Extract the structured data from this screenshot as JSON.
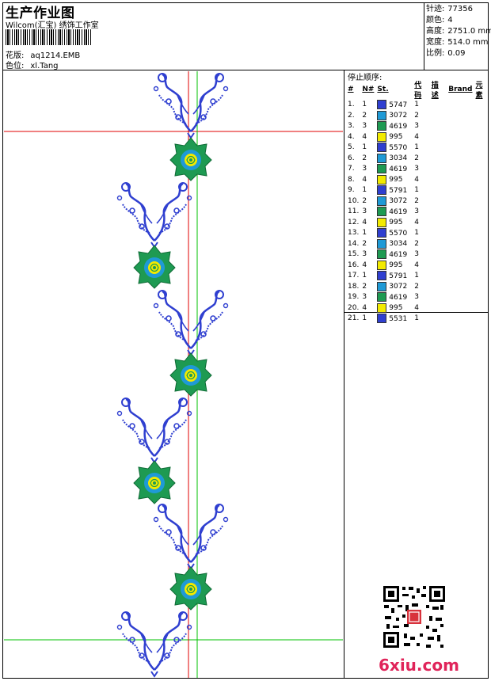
{
  "header": {
    "title": "生产作业图",
    "company": "Wilcom(汇宝) 绣饰工作室",
    "pattern_label": "花版:",
    "pattern_value": "aq1214.EMB",
    "color_label": "色位:",
    "color_value": "xl.Tang"
  },
  "stats": [
    {
      "label": "针迹:",
      "value": "77356"
    },
    {
      "label": "颜色:",
      "value": "4"
    },
    {
      "label": "高度:",
      "value": "2751.0 mm"
    },
    {
      "label": "宽度:",
      "value": "514.0 mm"
    },
    {
      "label": "比例:",
      "value": "0.09"
    }
  ],
  "stop_sequence": {
    "title": "停止顺序:",
    "columns": [
      "#",
      "N#",
      "St.",
      "代码",
      "描述",
      "Brand",
      "元素"
    ],
    "rows": [
      {
        "idx": "1.",
        "n": "1",
        "color": "#2f3fd0",
        "code": "5747",
        "desc": "1"
      },
      {
        "idx": "2.",
        "n": "2",
        "color": "#1f9ad6",
        "code": "3072",
        "desc": "2"
      },
      {
        "idx": "3.",
        "n": "3",
        "color": "#1e9a52",
        "code": "4619",
        "desc": "3"
      },
      {
        "idx": "4.",
        "n": "4",
        "color": "#f2ea00",
        "code": "995",
        "desc": "4"
      },
      {
        "idx": "5.",
        "n": "1",
        "color": "#2f3fd0",
        "code": "5570",
        "desc": "1"
      },
      {
        "idx": "6.",
        "n": "2",
        "color": "#1f9ad6",
        "code": "3034",
        "desc": "2"
      },
      {
        "idx": "7.",
        "n": "3",
        "color": "#1e9a52",
        "code": "4619",
        "desc": "3"
      },
      {
        "idx": "8.",
        "n": "4",
        "color": "#f2ea00",
        "code": "995",
        "desc": "4"
      },
      {
        "idx": "9.",
        "n": "1",
        "color": "#2f3fd0",
        "code": "5791",
        "desc": "1"
      },
      {
        "idx": "10.",
        "n": "2",
        "color": "#1f9ad6",
        "code": "3072",
        "desc": "2"
      },
      {
        "idx": "11.",
        "n": "3",
        "color": "#1e9a52",
        "code": "4619",
        "desc": "3"
      },
      {
        "idx": "12.",
        "n": "4",
        "color": "#f2ea00",
        "code": "995",
        "desc": "4"
      },
      {
        "idx": "13.",
        "n": "1",
        "color": "#2f3fd0",
        "code": "5570",
        "desc": "1"
      },
      {
        "idx": "14.",
        "n": "2",
        "color": "#1f9ad6",
        "code": "3034",
        "desc": "2"
      },
      {
        "idx": "15.",
        "n": "3",
        "color": "#1e9a52",
        "code": "4619",
        "desc": "3"
      },
      {
        "idx": "16.",
        "n": "4",
        "color": "#f2ea00",
        "code": "995",
        "desc": "4"
      },
      {
        "idx": "17.",
        "n": "1",
        "color": "#2f3fd0",
        "code": "5791",
        "desc": "1"
      },
      {
        "idx": "18.",
        "n": "2",
        "color": "#1f9ad6",
        "code": "3072",
        "desc": "2"
      },
      {
        "idx": "19.",
        "n": "3",
        "color": "#1e9a52",
        "code": "4619",
        "desc": "3"
      },
      {
        "idx": "20.",
        "n": "4",
        "color": "#f2ea00",
        "code": "995",
        "desc": "4"
      },
      {
        "idx": "21.",
        "n": "1",
        "color": "#2f3fd0",
        "code": "5531",
        "desc": "1"
      }
    ]
  },
  "watermark": "6xiu.com",
  "colors": {
    "blue": "#2f3fd0",
    "green": "#1e9a52",
    "teal": "#1f9ad6",
    "yellow": "#f2ea00",
    "guide_red": "#e00000",
    "guide_green": "#00c000",
    "watermark": "#e0245a"
  }
}
